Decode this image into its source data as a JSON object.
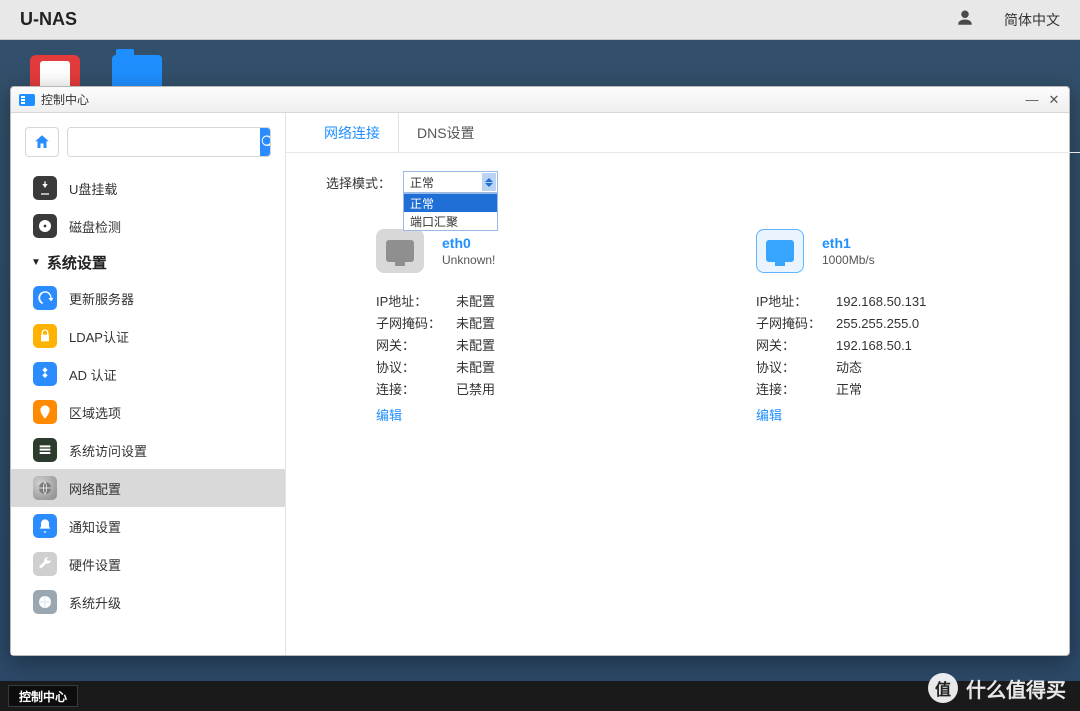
{
  "header": {
    "brand": "U-NAS",
    "language": "简体中文"
  },
  "desktop": {
    "taskbar_button": "控制中心"
  },
  "window": {
    "title": "控制中心",
    "sidebar": {
      "items_top": [
        {
          "label": "U盘挂载"
        },
        {
          "label": "磁盘检测"
        }
      ],
      "group": "系统设置",
      "items": [
        {
          "label": "更新服务器"
        },
        {
          "label": "LDAP认证"
        },
        {
          "label": "AD 认证"
        },
        {
          "label": "区域选项"
        },
        {
          "label": "系统访问设置"
        },
        {
          "label": "网络配置"
        },
        {
          "label": "通知设置"
        },
        {
          "label": "硬件设置"
        },
        {
          "label": "系统升级"
        }
      ],
      "active_index": 5
    },
    "tabs": [
      "网络连接",
      "DNS设置"
    ],
    "active_tab": 0,
    "mode": {
      "label": "选择模式：",
      "selected": "正常",
      "options": [
        "正常",
        "端口汇聚"
      ]
    },
    "field_labels": {
      "ip": "IP地址：",
      "mask": "子网掩码：",
      "gw": "网关：",
      "proto": "协议：",
      "conn": "连接：",
      "edit": "编辑"
    },
    "nics": [
      {
        "name": "eth0",
        "speed": "Unknown!",
        "status": "off",
        "ip": "未配置",
        "mask": "未配置",
        "gw": "未配置",
        "proto": "未配置",
        "conn": "已禁用"
      },
      {
        "name": "eth1",
        "speed": "1000Mb/s",
        "status": "on",
        "ip": "192.168.50.131",
        "mask": "255.255.255.0",
        "gw": "192.168.50.1",
        "proto": "动态",
        "conn": "正常"
      }
    ]
  },
  "watermark": {
    "char": "值",
    "text": "什么值得买"
  }
}
